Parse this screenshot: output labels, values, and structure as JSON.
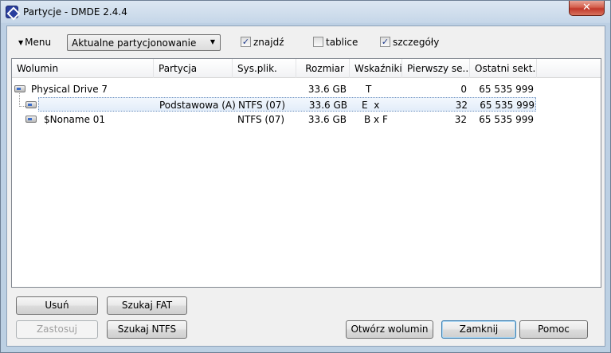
{
  "window": {
    "title": "Partycje - DMDE 2.4.4",
    "close_glyph": "✕"
  },
  "toolbar": {
    "menu_label": "Menu",
    "menu_arrow": "▼",
    "mode_value": "Aktualne partycjonowanie",
    "combo_arrow": "▼",
    "checkboxes": [
      {
        "label": "znajdź",
        "checked": true
      },
      {
        "label": "tablice",
        "checked": false
      },
      {
        "label": "szczegóły",
        "checked": true
      }
    ]
  },
  "table": {
    "columns": [
      "Wolumin",
      "Partycja",
      "Sys.plik.",
      "Rozmiar",
      "Wskaźniki",
      "Pierwszy se...",
      "Ostatni sekt..."
    ],
    "rows": [
      {
        "volume": "Physical Drive 7",
        "partition": "",
        "fs": "",
        "size": "33.6 GB",
        "flags": "T",
        "first": "0",
        "last": "65 535 999"
      },
      {
        "volume": "",
        "partition": "Podstawowa (A)",
        "fs": "NTFS (07)",
        "size": "33.6 GB",
        "flags": "E  x",
        "first": "32",
        "last": "65 535 999"
      },
      {
        "volume": "$Noname 01",
        "partition": "",
        "fs": "NTFS (07)",
        "size": "33.6 GB",
        "flags": "B x F",
        "first": "32",
        "last": "65 535 999"
      }
    ]
  },
  "buttons": {
    "delete": "Usuń",
    "search_fat": "Szukaj FAT",
    "apply": "Zastosuj",
    "search_ntfs": "Szukaj NTFS",
    "open_volume": "Otwórz wolumin",
    "close": "Zamknij",
    "help": "Pomoc"
  },
  "colors": {
    "selection_border": "#6b8fbf",
    "check_mark": "#1e3a8a"
  }
}
